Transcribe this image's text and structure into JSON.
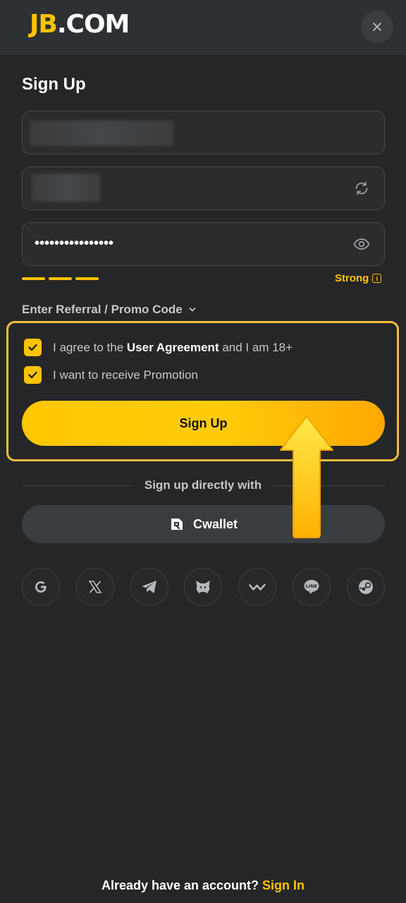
{
  "header": {
    "logo_part1": "JB",
    "logo_part2": ".COM",
    "close_icon": "close-icon"
  },
  "form": {
    "title": "Sign Up",
    "password_value": "••••••••••••••••",
    "strength_label": "Strong",
    "strength_segments": 3,
    "referral_label": "Enter Referral / Promo Code",
    "agree_prefix": "I agree to the ",
    "agree_link": "User Agreement",
    "agree_suffix": " and I am 18+",
    "agree_checked": true,
    "promo_label": "I want to receive Promotion",
    "promo_checked": true,
    "submit_label": "Sign Up"
  },
  "social": {
    "divider_text": "Sign up directly with",
    "cwallet_label": "Cwallet",
    "providers": [
      "google-icon",
      "x-icon",
      "telegram-icon",
      "metamask-icon",
      "walletconnect-icon",
      "line-icon",
      "steam-icon"
    ]
  },
  "footer": {
    "question": "Already have an account? ",
    "link": "Sign In"
  },
  "colors": {
    "accent": "#ffc300",
    "background": "#252627",
    "highlight_border": "#f5bd3c"
  }
}
